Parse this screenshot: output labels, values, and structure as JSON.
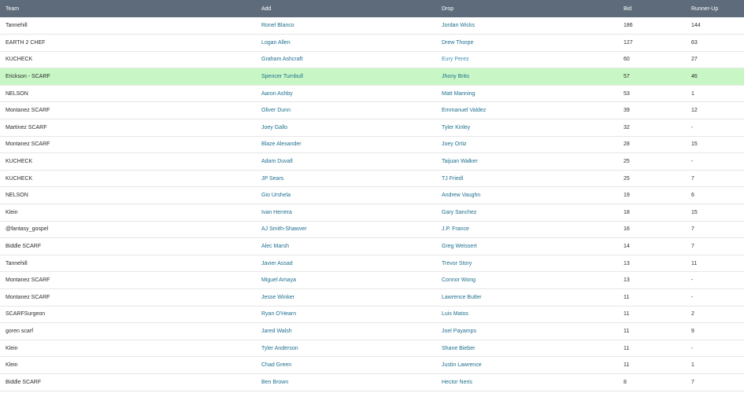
{
  "table": {
    "headers": {
      "team": "Team",
      "add": "Add",
      "drop": "Drop",
      "bid": "Bid",
      "runner_up": "Runner-Up"
    },
    "highlight_color": "#c8f7c5",
    "header_color": "#5e6b7a",
    "link_color": "#1d6f8f",
    "rows": [
      {
        "team": "Tannehill",
        "add": "Ronel Blanco",
        "drop": "Jordan Wicks",
        "bid": "186",
        "runner_up": "144"
      },
      {
        "team": "EARTH 2 CHEF",
        "add": "Logan Allen",
        "drop": "Drew Thorpe",
        "bid": "127",
        "runner_up": "63"
      },
      {
        "team": "KUCHECK",
        "add": "Graham Ashcraft",
        "drop": "Eury Perez",
        "bid": "60",
        "runner_up": "27"
      },
      {
        "team": "Erickson - SCARF",
        "add": "Spencer Turnbull",
        "drop": "Jhony Brito",
        "bid": "57",
        "runner_up": "46",
        "highlight": true
      },
      {
        "team": "NELSON",
        "add": "Aaron Ashby",
        "drop": "Matt Manning",
        "bid": "53",
        "runner_up": "1"
      },
      {
        "team": "Montanez SCARF",
        "add": "Oliver Dunn",
        "drop": "Emmanuel Valdez",
        "bid": "39",
        "runner_up": "12"
      },
      {
        "team": "Martinez SCARF",
        "add": "Joey Gallo",
        "drop": "Tyler Kinley",
        "bid": "32",
        "runner_up": "-"
      },
      {
        "team": "Montanez SCARF",
        "add": "Blaze Alexander",
        "drop": "Joey Ortiz",
        "bid": "28",
        "runner_up": "15"
      },
      {
        "team": "KUCHECK",
        "add": "Adam Duvall",
        "drop": "Taijuan Walker",
        "bid": "25",
        "runner_up": "-"
      },
      {
        "team": "KUCHECK",
        "add": "JP Sears",
        "drop": "TJ Friedl",
        "bid": "25",
        "runner_up": "7"
      },
      {
        "team": "NELSON",
        "add": "Gio Urshela",
        "drop": "Andrew Vaughn",
        "bid": "19",
        "runner_up": "6"
      },
      {
        "team": "Klein",
        "add": "Ivan Herrera",
        "drop": "Gary Sanchez",
        "bid": "18",
        "runner_up": "15"
      },
      {
        "team": "@fantasy_gospel",
        "add": "AJ Smith-Shawver",
        "drop": "J.P. France",
        "bid": "16",
        "runner_up": "7"
      },
      {
        "team": "Biddle SCARF",
        "add": "Alec Marsh",
        "drop": "Greg Weissert",
        "bid": "14",
        "runner_up": "7"
      },
      {
        "team": "Tannehill",
        "add": "Javier Assad",
        "drop": "Trevor Story",
        "bid": "13",
        "runner_up": "11"
      },
      {
        "team": "Montanez SCARF",
        "add": "Miguel Amaya",
        "drop": "Connor Wong",
        "bid": "13",
        "runner_up": "-"
      },
      {
        "team": "Montanez SCARF",
        "add": "Jesse Winker",
        "drop": "Lawrence Butler",
        "bid": "11",
        "runner_up": "-"
      },
      {
        "team": "SCARFSurgeon",
        "add": "Ryan O'Hearn",
        "drop": "Luis Matos",
        "bid": "11",
        "runner_up": "2"
      },
      {
        "team": "goren scarf",
        "add": "Jared Walsh",
        "drop": "Joel Payamps",
        "bid": "11",
        "runner_up": "9"
      },
      {
        "team": "Klein",
        "add": "Tyler Anderson",
        "drop": "Shane Bieber",
        "bid": "11",
        "runner_up": "-"
      },
      {
        "team": "Klein",
        "add": "Chad Green",
        "drop": "Justin Lawrence",
        "bid": "11",
        "runner_up": "1"
      },
      {
        "team": "Biddle SCARF",
        "add": "Ben Brown",
        "drop": "Hector Neris",
        "bid": "8",
        "runner_up": "7"
      }
    ]
  }
}
